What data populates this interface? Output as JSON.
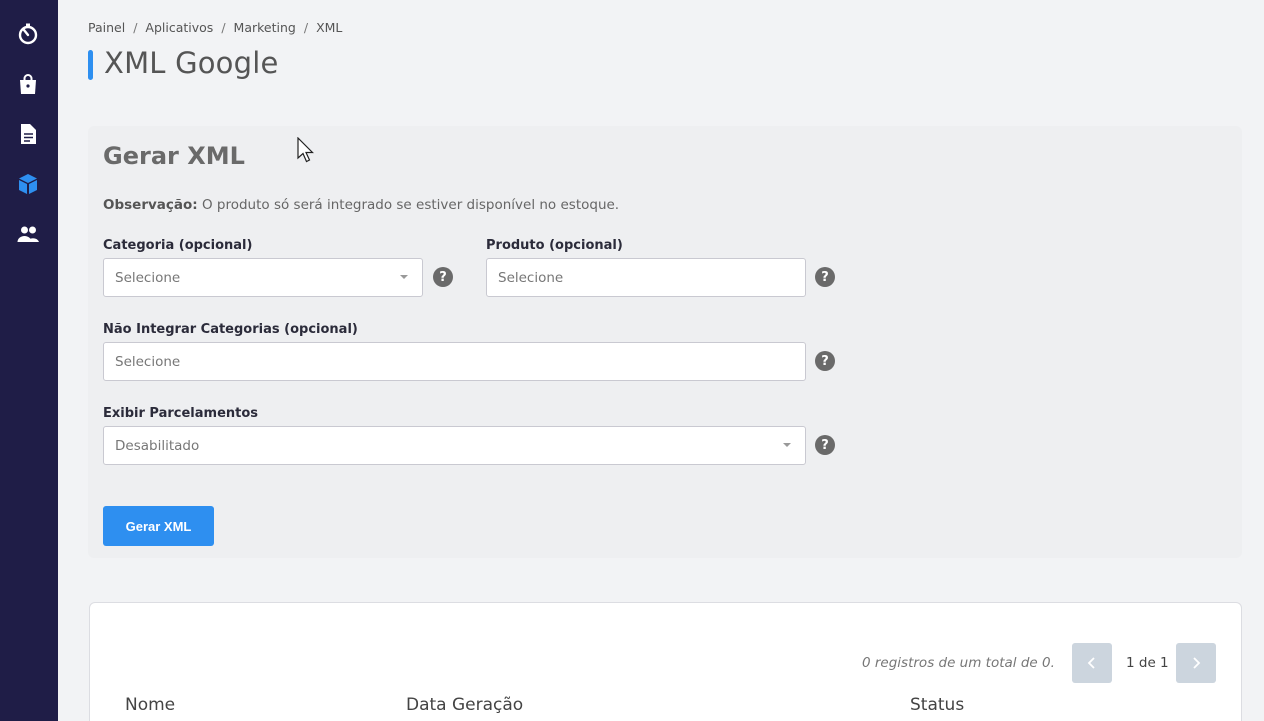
{
  "sidebar": {
    "items": [
      {
        "icon": "stopwatch-icon"
      },
      {
        "icon": "shopping-bag-icon"
      },
      {
        "icon": "document-icon"
      },
      {
        "icon": "cube-icon",
        "active": true
      },
      {
        "icon": "users-icon"
      }
    ],
    "colors": {
      "background": "#1f1d47",
      "active": "#2e8ff0"
    }
  },
  "breadcrumb": {
    "items": [
      "Painel",
      "Aplicativos",
      "Marketing",
      "XML"
    ],
    "separator": "/"
  },
  "page": {
    "title": "XML Google"
  },
  "form": {
    "title": "Gerar XML",
    "note_label": "Observação:",
    "note_text": " O produto só será integrado se estiver disponível no estoque.",
    "categoria": {
      "label": "Categoria (opcional)",
      "value": "Selecione"
    },
    "produto": {
      "label": "Produto (opcional)",
      "placeholder": "Selecione"
    },
    "nao_integrar": {
      "label": "Não Integrar Categorias (opcional)",
      "placeholder": "Selecione"
    },
    "parcelamentos": {
      "label": "Exibir Parcelamentos",
      "value": "Desabilitado"
    },
    "help_glyph": "?",
    "submit_label": "Gerar XML"
  },
  "table": {
    "records_text": "0 registros de um total de 0.",
    "pagination_text": "1 de 1",
    "columns": [
      "Nome",
      "Data Geração",
      "Status"
    ]
  },
  "colors": {
    "accent": "#2e8ff0"
  }
}
